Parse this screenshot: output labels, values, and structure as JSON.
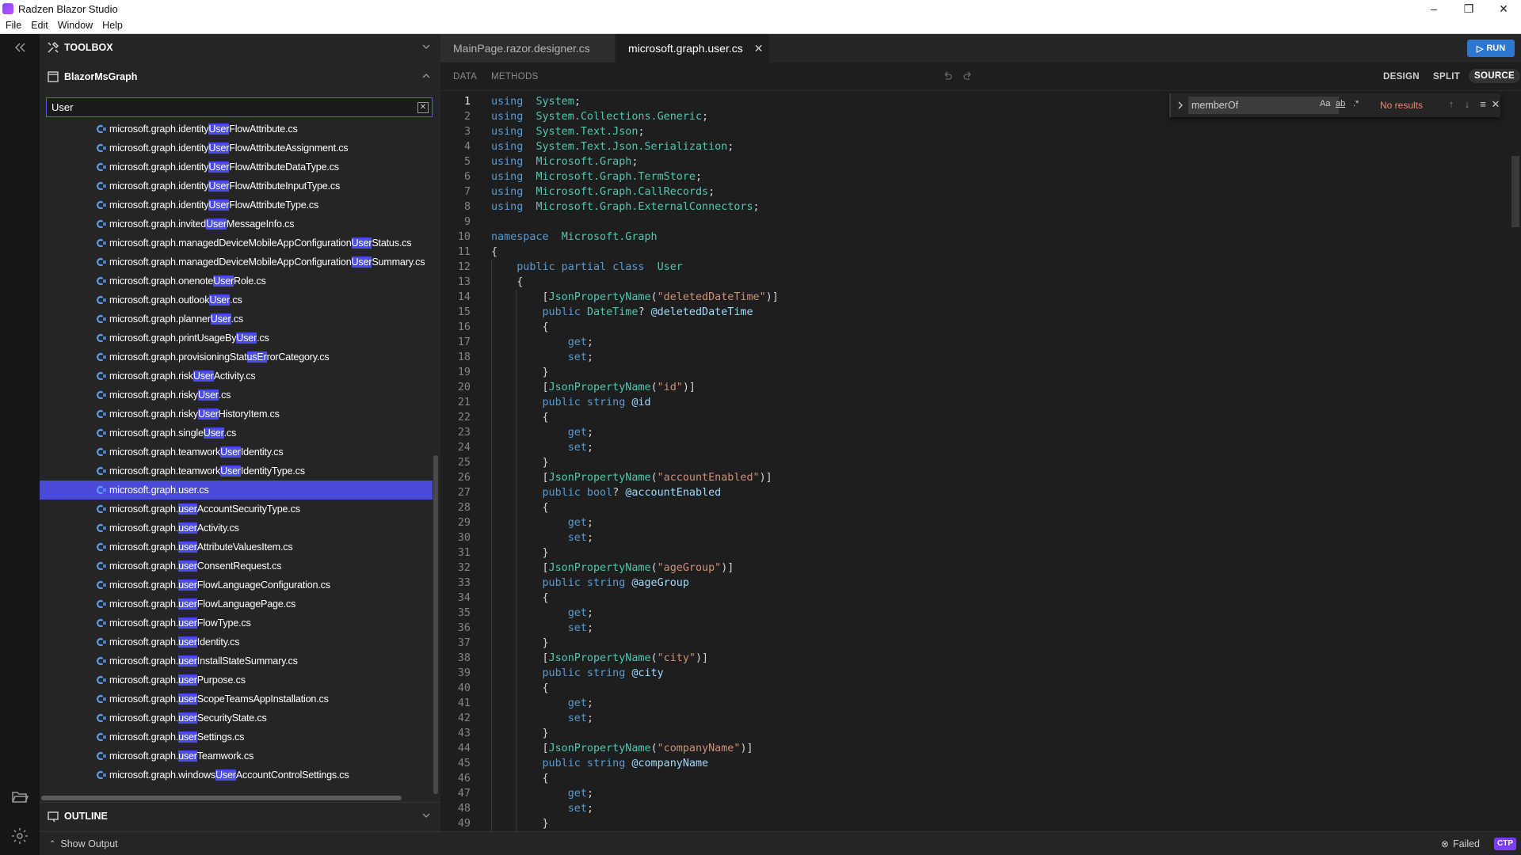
{
  "window": {
    "title": "Radzen Blazor Studio",
    "controls": [
      "minimize",
      "restore",
      "close"
    ]
  },
  "menu": [
    "File",
    "Edit",
    "Window",
    "Help"
  ],
  "toolbox": {
    "label": "TOOLBOX"
  },
  "project": {
    "label": "BlazorMsGraph"
  },
  "search": {
    "value": "User",
    "placeholder": ""
  },
  "files": [
    {
      "pre": "microsoft.graph.identity",
      "match": "User",
      "post": "FlowAttribute.cs"
    },
    {
      "pre": "microsoft.graph.identity",
      "match": "User",
      "post": "FlowAttributeAssignment.cs"
    },
    {
      "pre": "microsoft.graph.identity",
      "match": "User",
      "post": "FlowAttributeDataType.cs"
    },
    {
      "pre": "microsoft.graph.identity",
      "match": "User",
      "post": "FlowAttributeInputType.cs"
    },
    {
      "pre": "microsoft.graph.identity",
      "match": "User",
      "post": "FlowAttributeType.cs"
    },
    {
      "pre": "microsoft.graph.invited",
      "match": "User",
      "post": "MessageInfo.cs"
    },
    {
      "pre": "microsoft.graph.managedDeviceMobileAppConfiguration",
      "match": "User",
      "post": "Status.cs"
    },
    {
      "pre": "microsoft.graph.managedDeviceMobileAppConfiguration",
      "match": "User",
      "post": "Summary.cs"
    },
    {
      "pre": "microsoft.graph.onenote",
      "match": "User",
      "post": "Role.cs"
    },
    {
      "pre": "microsoft.graph.outlook",
      "match": "User",
      "post": ".cs"
    },
    {
      "pre": "microsoft.graph.planner",
      "match": "User",
      "post": ".cs"
    },
    {
      "pre": "microsoft.graph.printUsageBy",
      "match": "User",
      "post": ".cs"
    },
    {
      "pre": "microsoft.graph.provisioningStat",
      "match": "usEr",
      "post": "rorCategory.cs"
    },
    {
      "pre": "microsoft.graph.risk",
      "match": "User",
      "post": "Activity.cs"
    },
    {
      "pre": "microsoft.graph.risky",
      "match": "User",
      "post": ".cs"
    },
    {
      "pre": "microsoft.graph.risky",
      "match": "User",
      "post": "HistoryItem.cs"
    },
    {
      "pre": "microsoft.graph.single",
      "match": "User",
      "post": ".cs"
    },
    {
      "pre": "microsoft.graph.teamwork",
      "match": "User",
      "post": "Identity.cs"
    },
    {
      "pre": "microsoft.graph.teamwork",
      "match": "User",
      "post": "IdentityType.cs"
    },
    {
      "pre": "microsoft.graph.user.cs",
      "match": "",
      "post": "",
      "selected": true
    },
    {
      "pre": "microsoft.graph.",
      "match": "user",
      "post": "AccountSecurityType.cs"
    },
    {
      "pre": "microsoft.graph.",
      "match": "user",
      "post": "Activity.cs"
    },
    {
      "pre": "microsoft.graph.",
      "match": "user",
      "post": "AttributeValuesItem.cs"
    },
    {
      "pre": "microsoft.graph.",
      "match": "user",
      "post": "ConsentRequest.cs"
    },
    {
      "pre": "microsoft.graph.",
      "match": "user",
      "post": "FlowLanguageConfiguration.cs"
    },
    {
      "pre": "microsoft.graph.",
      "match": "user",
      "post": "FlowLanguagePage.cs"
    },
    {
      "pre": "microsoft.graph.",
      "match": "user",
      "post": "FlowType.cs"
    },
    {
      "pre": "microsoft.graph.",
      "match": "user",
      "post": "Identity.cs"
    },
    {
      "pre": "microsoft.graph.",
      "match": "user",
      "post": "InstallStateSummary.cs"
    },
    {
      "pre": "microsoft.graph.",
      "match": "user",
      "post": "Purpose.cs"
    },
    {
      "pre": "microsoft.graph.",
      "match": "user",
      "post": "ScopeTeamsAppInstallation.cs"
    },
    {
      "pre": "microsoft.graph.",
      "match": "user",
      "post": "SecurityState.cs"
    },
    {
      "pre": "microsoft.graph.",
      "match": "user",
      "post": "Settings.cs"
    },
    {
      "pre": "microsoft.graph.",
      "match": "user",
      "post": "Teamwork.cs"
    },
    {
      "pre": "microsoft.graph.windows",
      "match": "User",
      "post": "AccountControlSettings.cs"
    }
  ],
  "outline": {
    "label": "OUTLINE"
  },
  "output": {
    "label": "Show Output",
    "status": "Failed",
    "badge": "CTP"
  },
  "tabs": [
    {
      "label": "MainPage.razor.designer.cs",
      "active": false
    },
    {
      "label": "microsoft.graph.user.cs",
      "active": true
    }
  ],
  "run": {
    "label": "RUN"
  },
  "editor_toolbar": {
    "left": [
      "DATA",
      "METHODS"
    ],
    "modes": [
      "DESIGN",
      "SPLIT",
      "SOURCE"
    ],
    "active_mode": "SOURCE"
  },
  "find": {
    "value": "memberOf",
    "result": "No results",
    "options": [
      "Aa",
      "ab",
      ".*"
    ]
  },
  "code_lines": [
    [
      [
        "kw",
        "using"
      ],
      [
        "",
        "  "
      ],
      [
        "ty",
        "System"
      ],
      [
        "",
        ";"
      ]
    ],
    [
      [
        "kw",
        "using"
      ],
      [
        "",
        "  "
      ],
      [
        "ty",
        "System.Collections.Generic"
      ],
      [
        "",
        ";"
      ]
    ],
    [
      [
        "kw",
        "using"
      ],
      [
        "",
        "  "
      ],
      [
        "ty",
        "System.Text.Json"
      ],
      [
        "",
        ";"
      ]
    ],
    [
      [
        "kw",
        "using"
      ],
      [
        "",
        "  "
      ],
      [
        "ty",
        "System.Text.Json.Serialization"
      ],
      [
        "",
        ";"
      ]
    ],
    [
      [
        "kw",
        "using"
      ],
      [
        "",
        "  "
      ],
      [
        "ty",
        "Microsoft.Graph"
      ],
      [
        "",
        ";"
      ]
    ],
    [
      [
        "kw",
        "using"
      ],
      [
        "",
        "  "
      ],
      [
        "ty",
        "Microsoft.Graph.TermStore"
      ],
      [
        "",
        ";"
      ]
    ],
    [
      [
        "kw",
        "using"
      ],
      [
        "",
        "  "
      ],
      [
        "ty",
        "Microsoft.Graph.CallRecords"
      ],
      [
        "",
        ";"
      ]
    ],
    [
      [
        "kw",
        "using"
      ],
      [
        "",
        "  "
      ],
      [
        "ty",
        "Microsoft.Graph.ExternalConnectors"
      ],
      [
        "",
        ";"
      ]
    ],
    [],
    [
      [
        "kw",
        "namespace"
      ],
      [
        "",
        "  "
      ],
      [
        "ty",
        "Microsoft.Graph"
      ]
    ],
    [
      [
        "",
        "{"
      ]
    ],
    [
      [
        "",
        "    "
      ],
      [
        "kw",
        "public partial class"
      ],
      [
        "",
        "  "
      ],
      [
        "ty",
        "User"
      ]
    ],
    [
      [
        "",
        "    {"
      ]
    ],
    [
      [
        "",
        "        ["
      ],
      [
        "ty",
        "JsonPropertyName"
      ],
      [
        "",
        "("
      ],
      [
        "str",
        "\"deletedDateTime\""
      ],
      [
        "",
        ")]"
      ]
    ],
    [
      [
        "",
        "        "
      ],
      [
        "kw",
        "public"
      ],
      [
        "",
        " "
      ],
      [
        "ty",
        "DateTime"
      ],
      [
        "",
        "? "
      ],
      [
        "id",
        "@deletedDateTime"
      ]
    ],
    [
      [
        "",
        "        {"
      ]
    ],
    [
      [
        "",
        "            "
      ],
      [
        "kw",
        "get"
      ],
      [
        "",
        ";"
      ]
    ],
    [
      [
        "",
        "            "
      ],
      [
        "kw",
        "set"
      ],
      [
        "",
        ";"
      ]
    ],
    [
      [
        "",
        "        }"
      ]
    ],
    [
      [
        "",
        "        ["
      ],
      [
        "ty",
        "JsonPropertyName"
      ],
      [
        "",
        "("
      ],
      [
        "str",
        "\"id\""
      ],
      [
        "",
        ")]"
      ]
    ],
    [
      [
        "",
        "        "
      ],
      [
        "kw",
        "public string"
      ],
      [
        "",
        " "
      ],
      [
        "id",
        "@id"
      ]
    ],
    [
      [
        "",
        "        {"
      ]
    ],
    [
      [
        "",
        "            "
      ],
      [
        "kw",
        "get"
      ],
      [
        "",
        ";"
      ]
    ],
    [
      [
        "",
        "            "
      ],
      [
        "kw",
        "set"
      ],
      [
        "",
        ";"
      ]
    ],
    [
      [
        "",
        "        }"
      ]
    ],
    [
      [
        "",
        "        ["
      ],
      [
        "ty",
        "JsonPropertyName"
      ],
      [
        "",
        "("
      ],
      [
        "str",
        "\"accountEnabled\""
      ],
      [
        "",
        ")]"
      ]
    ],
    [
      [
        "",
        "        "
      ],
      [
        "kw",
        "public bool"
      ],
      [
        "",
        "? "
      ],
      [
        "id",
        "@accountEnabled"
      ]
    ],
    [
      [
        "",
        "        {"
      ]
    ],
    [
      [
        "",
        "            "
      ],
      [
        "kw",
        "get"
      ],
      [
        "",
        ";"
      ]
    ],
    [
      [
        "",
        "            "
      ],
      [
        "kw",
        "set"
      ],
      [
        "",
        ";"
      ]
    ],
    [
      [
        "",
        "        }"
      ]
    ],
    [
      [
        "",
        "        ["
      ],
      [
        "ty",
        "JsonPropertyName"
      ],
      [
        "",
        "("
      ],
      [
        "str",
        "\"ageGroup\""
      ],
      [
        "",
        ")]"
      ]
    ],
    [
      [
        "",
        "        "
      ],
      [
        "kw",
        "public string"
      ],
      [
        "",
        " "
      ],
      [
        "id",
        "@ageGroup"
      ]
    ],
    [
      [
        "",
        "        {"
      ]
    ],
    [
      [
        "",
        "            "
      ],
      [
        "kw",
        "get"
      ],
      [
        "",
        ";"
      ]
    ],
    [
      [
        "",
        "            "
      ],
      [
        "kw",
        "set"
      ],
      [
        "",
        ";"
      ]
    ],
    [
      [
        "",
        "        }"
      ]
    ],
    [
      [
        "",
        "        ["
      ],
      [
        "ty",
        "JsonPropertyName"
      ],
      [
        "",
        "("
      ],
      [
        "str",
        "\"city\""
      ],
      [
        "",
        ")]"
      ]
    ],
    [
      [
        "",
        "        "
      ],
      [
        "kw",
        "public string"
      ],
      [
        "",
        " "
      ],
      [
        "id",
        "@city"
      ]
    ],
    [
      [
        "",
        "        {"
      ]
    ],
    [
      [
        "",
        "            "
      ],
      [
        "kw",
        "get"
      ],
      [
        "",
        ";"
      ]
    ],
    [
      [
        "",
        "            "
      ],
      [
        "kw",
        "set"
      ],
      [
        "",
        ";"
      ]
    ],
    [
      [
        "",
        "        }"
      ]
    ],
    [
      [
        "",
        "        ["
      ],
      [
        "ty",
        "JsonPropertyName"
      ],
      [
        "",
        "("
      ],
      [
        "str",
        "\"companyName\""
      ],
      [
        "",
        ")]"
      ]
    ],
    [
      [
        "",
        "        "
      ],
      [
        "kw",
        "public string"
      ],
      [
        "",
        " "
      ],
      [
        "id",
        "@companyName"
      ]
    ],
    [
      [
        "",
        "        {"
      ]
    ],
    [
      [
        "",
        "            "
      ],
      [
        "kw",
        "get"
      ],
      [
        "",
        ";"
      ]
    ],
    [
      [
        "",
        "            "
      ],
      [
        "kw",
        "set"
      ],
      [
        "",
        ";"
      ]
    ],
    [
      [
        "",
        "        }"
      ]
    ]
  ],
  "colors": {
    "accent": "#4a4ad9",
    "run": "#2e77d0",
    "badge": "#7a3cff",
    "error": "#f48771"
  }
}
